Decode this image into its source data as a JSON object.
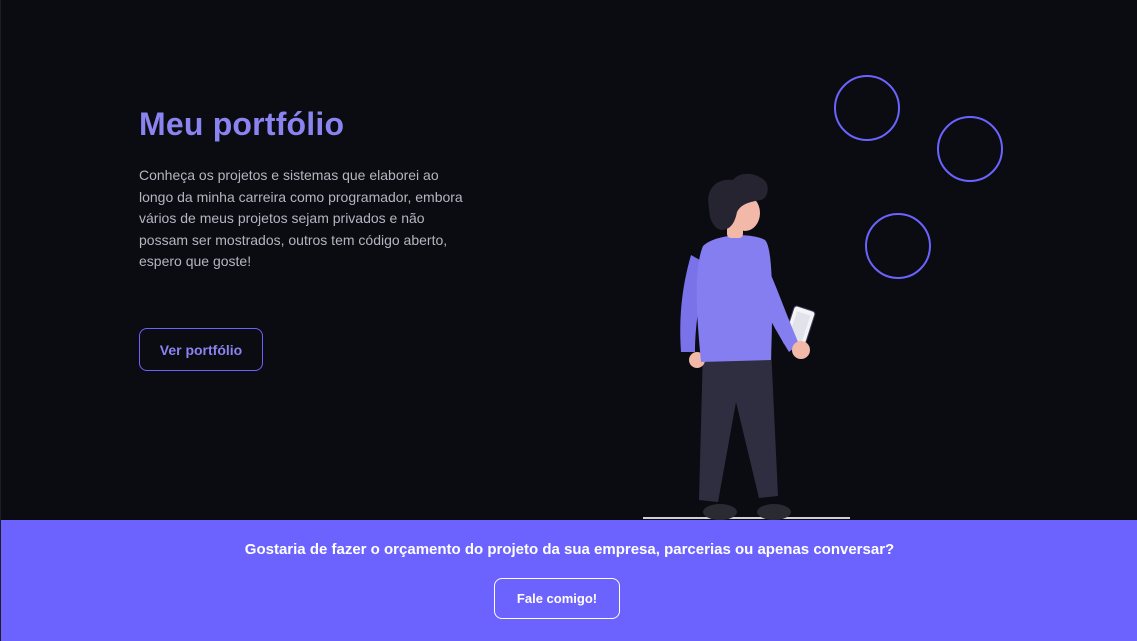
{
  "hero": {
    "title": "Meu portfólio",
    "description": "Conheça os projetos e sistemas que elaborei ao longo da minha carreira como programador, embora vários de meus projetos sejam privados e não possam ser mostrados, outros tem código aberto, espero que goste!",
    "button_label": "Ver portfólio"
  },
  "illustration": {
    "icon": "person-holding-phone-illustration",
    "decoration": "circle-outlines"
  },
  "cta": {
    "text": "Gostaria de fazer o orçamento do projeto da sua empresa, parcerias ou apenas conversar?",
    "button_label": "Fale comigo!"
  },
  "colors": {
    "background": "#0a0c12",
    "accent": "#6c63ff",
    "title": "#8a83f0",
    "text": "#b3b6c0",
    "cta_text": "#ffffff"
  }
}
